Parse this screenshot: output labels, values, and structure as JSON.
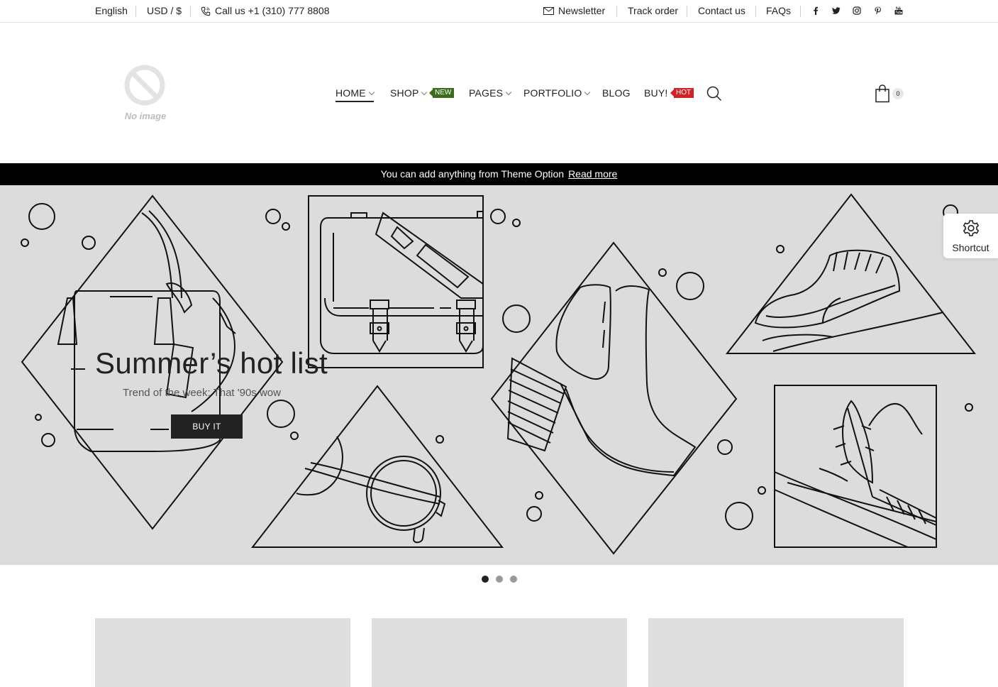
{
  "topbar": {
    "language": "English",
    "currency": "USD / $",
    "phone": "Call us +1 (310) 777 8808",
    "links": [
      "Newsletter",
      "Track order",
      "Contact us",
      "FAQs"
    ],
    "social_icons": [
      "facebook-icon",
      "twitter-icon",
      "instagram-icon",
      "pinterest-icon",
      "youtube-icon"
    ]
  },
  "logo": {
    "text": "No image"
  },
  "nav": {
    "items": [
      "HOME",
      "SHOP",
      "PAGES",
      "PORTFOLIO",
      "BLOG",
      "BUY!"
    ],
    "badge_new": "NEW",
    "badge_hot": "HOT"
  },
  "cart": {
    "count": "0"
  },
  "announcement": {
    "text": "You can add anything from Theme Option",
    "link": "Read more"
  },
  "hero": {
    "title": "Summer’s hot list",
    "subtitle": "Trend of the week: That '90s wow",
    "button": "BUY IT"
  },
  "shortcut": {
    "label": "Shortcut"
  },
  "colors": {
    "accent_new": "#3d6b1c",
    "accent_hot": "#d02227",
    "hero_bg": "#dcdcdc",
    "announce_bg": "#000000"
  }
}
